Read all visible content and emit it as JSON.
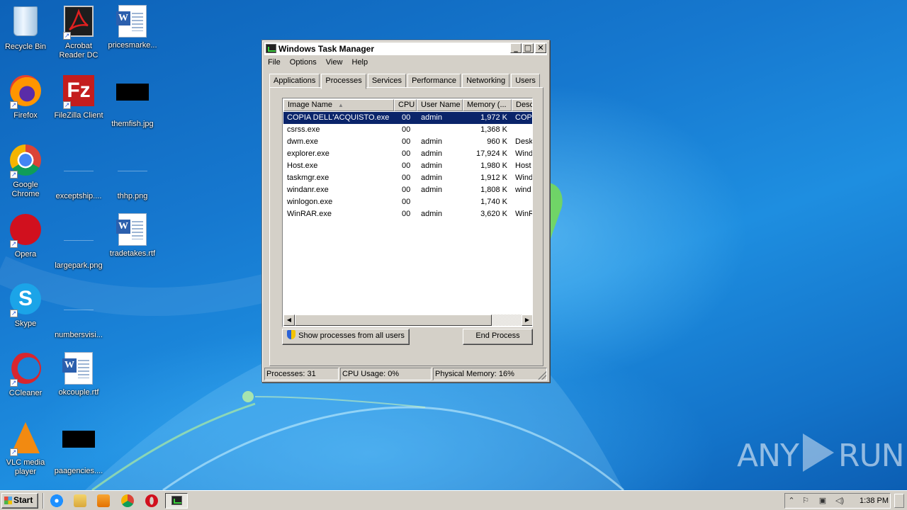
{
  "desktop": {
    "icons": [
      {
        "label": "Recycle Bin",
        "icon": "recycle-bin-icon"
      },
      {
        "label": "Acrobat Reader DC",
        "icon": "acrobat-icon"
      },
      {
        "label": "pricesmarke...",
        "icon": "word-document-icon"
      },
      {
        "label": "Firefox",
        "icon": "firefox-icon"
      },
      {
        "label": "FileZilla Client",
        "icon": "filezilla-icon"
      },
      {
        "label": "themfish.jpg",
        "icon": "image-file-icon"
      },
      {
        "label": "Google Chrome",
        "icon": "chrome-icon"
      },
      {
        "label": "exceptship....",
        "icon": "blank-file-icon"
      },
      {
        "label": "thhp.png",
        "icon": "blank-file-icon"
      },
      {
        "label": "Opera",
        "icon": "opera-icon"
      },
      {
        "label": "largepark.png",
        "icon": "blank-file-icon"
      },
      {
        "label": "tradetakes.rtf",
        "icon": "word-document-icon"
      },
      {
        "label": "Skype",
        "icon": "skype-icon"
      },
      {
        "label": "numbersvisi...",
        "icon": "blank-file-icon"
      },
      {
        "label": "CCleaner",
        "icon": "ccleaner-icon"
      },
      {
        "label": "okcouple.rtf",
        "icon": "word-document-icon"
      },
      {
        "label": "VLC media player",
        "icon": "vlc-icon"
      },
      {
        "label": "paagencies....",
        "icon": "image-file-icon"
      }
    ]
  },
  "window": {
    "title": "Windows Task Manager",
    "controls": {
      "minimize": "_",
      "maximize": "□",
      "close": "✕"
    },
    "menu": [
      "File",
      "Options",
      "View",
      "Help"
    ],
    "tabs": [
      "Applications",
      "Processes",
      "Services",
      "Performance",
      "Networking",
      "Users"
    ],
    "active_tab": "Processes",
    "columns": [
      "Image Name",
      "CPU",
      "User Name",
      "Memory (...",
      "Desc"
    ],
    "processes": [
      {
        "name": "COPIA DELL'ACQUISTO.exe",
        "cpu": "00",
        "user": "admin",
        "memory": "1,972 K",
        "desc": "COPI",
        "selected": true
      },
      {
        "name": "csrss.exe",
        "cpu": "00",
        "user": "",
        "memory": "1,368 K",
        "desc": ""
      },
      {
        "name": "dwm.exe",
        "cpu": "00",
        "user": "admin",
        "memory": "960 K",
        "desc": "Desk"
      },
      {
        "name": "explorer.exe",
        "cpu": "00",
        "user": "admin",
        "memory": "17,924 K",
        "desc": "Wind"
      },
      {
        "name": "Host.exe",
        "cpu": "00",
        "user": "admin",
        "memory": "1,980 K",
        "desc": "Host"
      },
      {
        "name": "taskmgr.exe",
        "cpu": "00",
        "user": "admin",
        "memory": "1,912 K",
        "desc": "Wind"
      },
      {
        "name": "windanr.exe",
        "cpu": "00",
        "user": "admin",
        "memory": "1,808 K",
        "desc": "wind"
      },
      {
        "name": "winlogon.exe",
        "cpu": "00",
        "user": "",
        "memory": "1,740 K",
        "desc": ""
      },
      {
        "name": "WinRAR.exe",
        "cpu": "00",
        "user": "admin",
        "memory": "3,620 K",
        "desc": "WinR"
      }
    ],
    "show_all_label": "Show processes from all users",
    "end_process_label": "End Process",
    "status": {
      "processes": "Processes: 31",
      "cpu": "CPU Usage: 0%",
      "memory": "Physical Memory: 16%"
    }
  },
  "taskbar": {
    "start_label": "Start",
    "clock": "1:38 PM"
  },
  "watermark": {
    "left": "ANY",
    "right": "RUN"
  }
}
